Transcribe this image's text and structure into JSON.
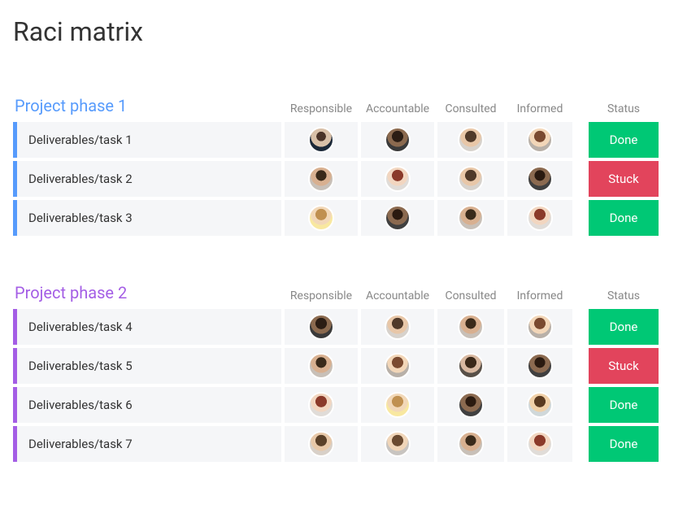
{
  "title": "Raci matrix",
  "columns": {
    "responsible": "Responsible",
    "accountable": "Accountable",
    "consulted": "Consulted",
    "informed": "Informed",
    "status": "Status"
  },
  "status_colors": {
    "done": "#00c875",
    "stuck": "#e2445c"
  },
  "phases": [
    {
      "id": "phase-1",
      "title": "Project phase 1",
      "accent_color": "#579bfc",
      "rows": [
        {
          "task": "Deliverables/task 1",
          "responsible": "person-a",
          "accountable": "person-b",
          "consulted": "person-c",
          "informed": "person-d",
          "status": "Done",
          "status_key": "done"
        },
        {
          "task": "Deliverables/task 2",
          "responsible": "person-e",
          "accountable": "person-f",
          "consulted": "person-c",
          "informed": "person-g",
          "status": "Stuck",
          "status_key": "stuck"
        },
        {
          "task": "Deliverables/task 3",
          "responsible": "person-i",
          "accountable": "person-g",
          "consulted": "person-e",
          "informed": "person-f",
          "status": "Done",
          "status_key": "done"
        }
      ]
    },
    {
      "id": "phase-2",
      "title": "Project phase 2",
      "accent_color": "#a45ee5",
      "rows": [
        {
          "task": "Deliverables/task 4",
          "responsible": "person-b",
          "accountable": "person-c",
          "consulted": "person-e",
          "informed": "person-d",
          "status": "Done",
          "status_key": "done"
        },
        {
          "task": "Deliverables/task 5",
          "responsible": "person-e",
          "accountable": "person-d",
          "consulted": "person-j",
          "informed": "person-g",
          "status": "Stuck",
          "status_key": "stuck"
        },
        {
          "task": "Deliverables/task 6",
          "responsible": "person-f",
          "accountable": "person-i",
          "consulted": "person-g",
          "informed": "person-h",
          "status": "Done",
          "status_key": "done"
        },
        {
          "task": "Deliverables/task 7",
          "responsible": "person-k",
          "accountable": "person-l",
          "consulted": "person-e",
          "informed": "person-f",
          "status": "Done",
          "status_key": "done"
        }
      ]
    }
  ]
}
